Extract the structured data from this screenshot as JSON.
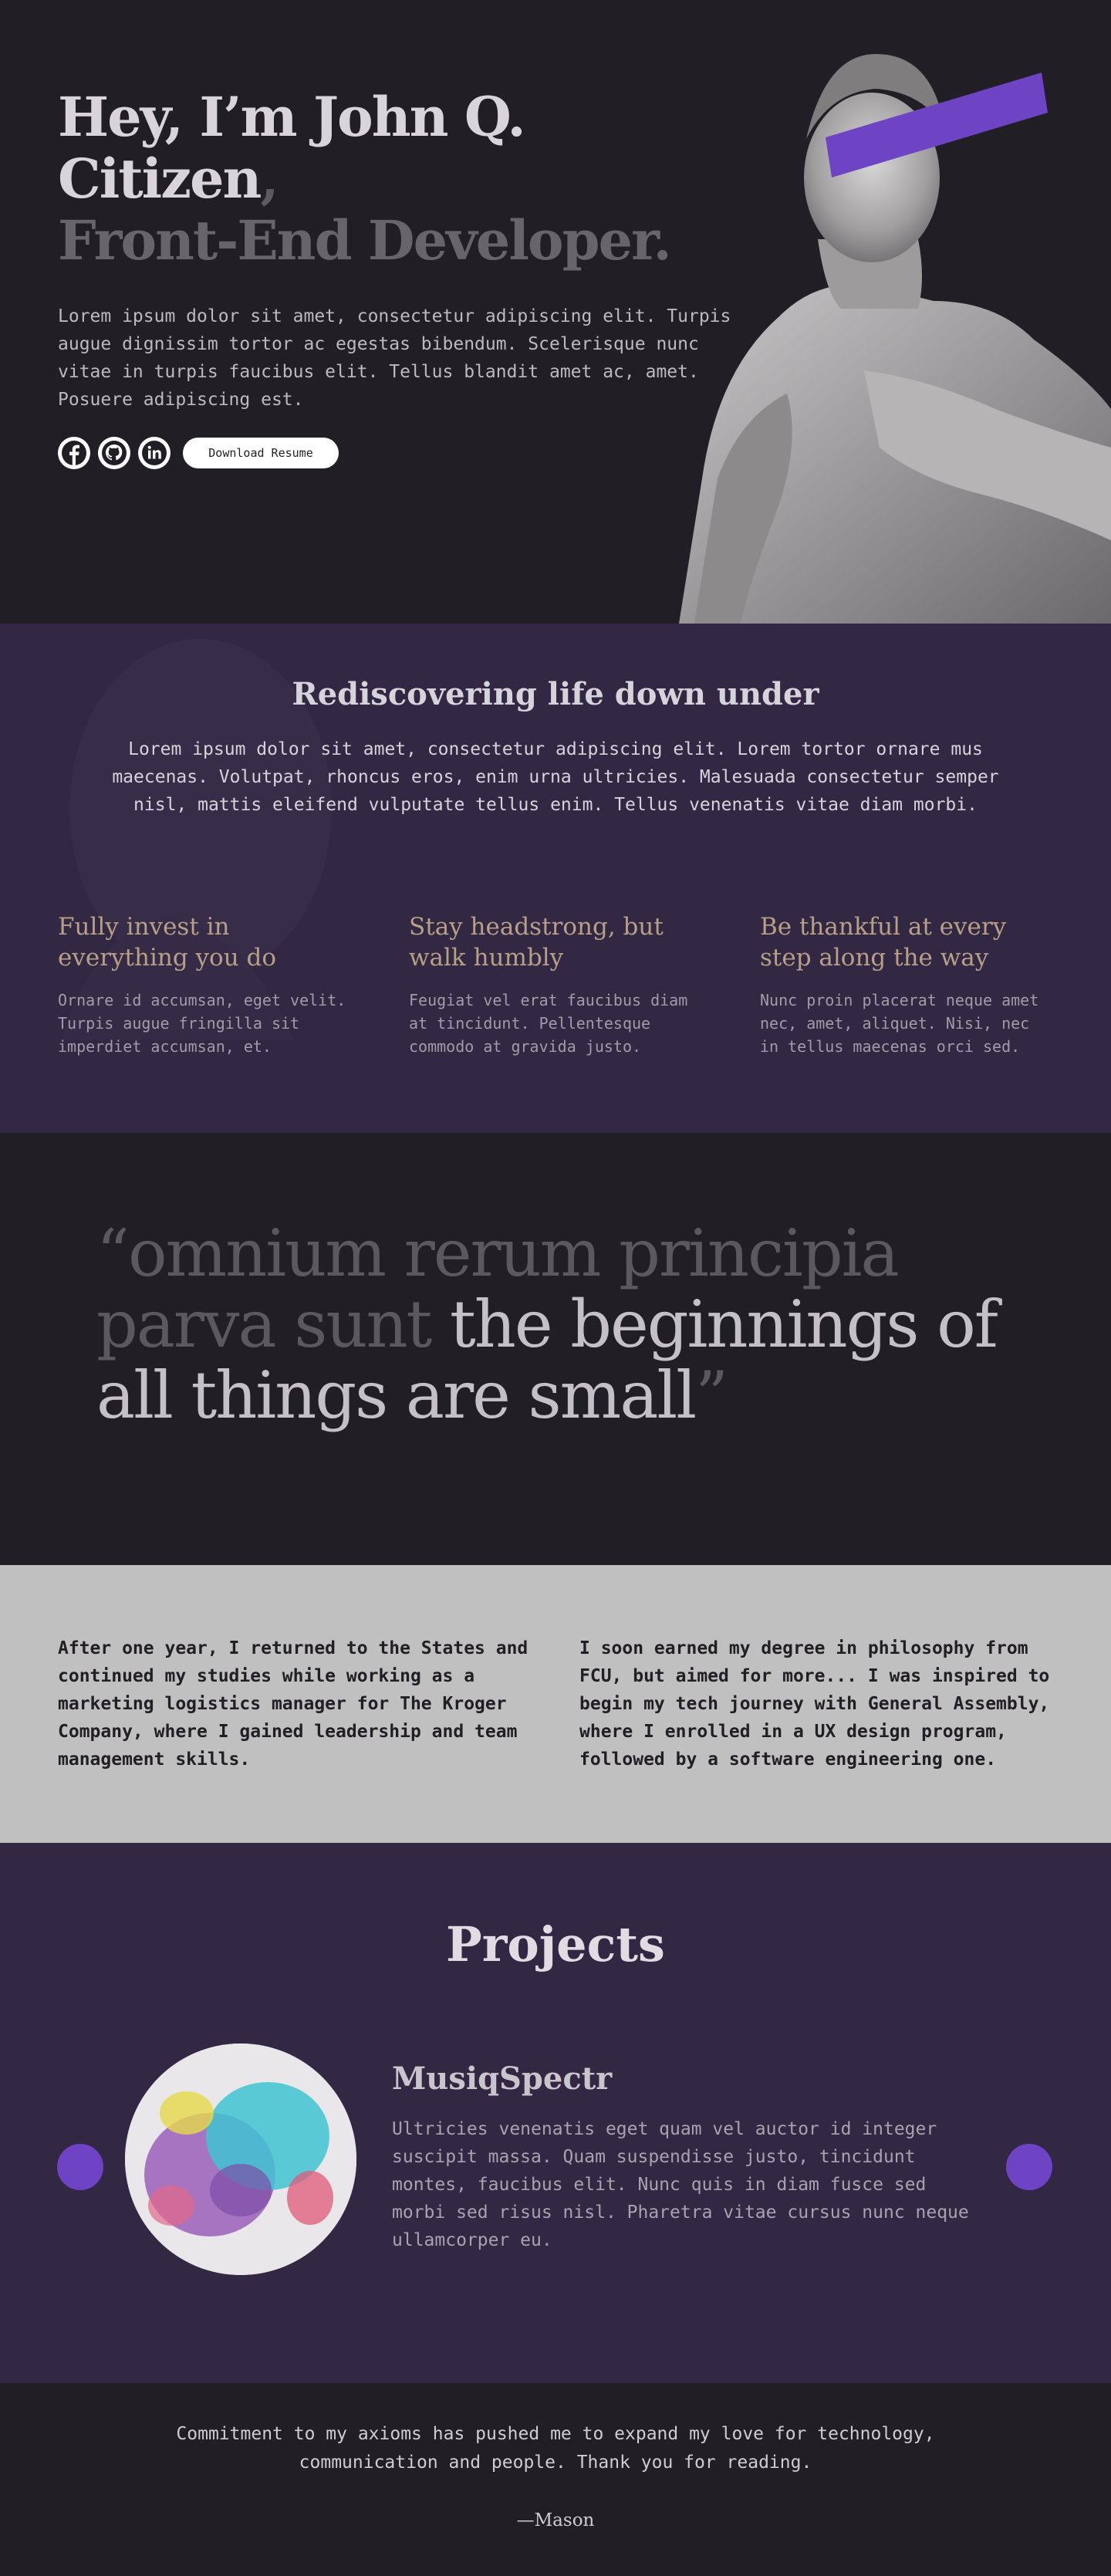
{
  "hero": {
    "title_line1": "Hey, I’m John Q. Citizen",
    "title_comma": ",",
    "title_line2": "Front-End Developer.",
    "description": "Lorem ipsum dolor sit amet, consectetur adipiscing elit. Turpis augue dignissim tortor ac egestas bibendum. Scelerisque nunc vitae in turpis faucibus elit. Tellus blandit amet ac, amet. Posuere adipiscing est.",
    "download_label": "Download Resume",
    "socials": [
      "facebook-icon",
      "github-icon",
      "linkedin-icon"
    ],
    "accent_color": "#6e44c4"
  },
  "about": {
    "title": "Rediscovering life down under",
    "lead": "Lorem ipsum dolor sit amet, consectetur adipiscing elit. Lorem tortor ornare mus maecenas. Volutpat, rhoncus eros, enim urna ultricies. Malesuada consectetur semper nisl, mattis eleifend vulputate tellus enim. Tellus venenatis vitae diam morbi.",
    "values": [
      {
        "title": "Fully invest in everything you do",
        "body": "Ornare id accumsan, eget velit. Turpis augue fringilla sit imperdiet accumsan, et."
      },
      {
        "title": "Stay headstrong, but walk humbly",
        "body": "Feugiat vel erat faucibus diam at tincidunt. Pellentesque commodo at gravida justo."
      },
      {
        "title": "Be thankful at every step along the way",
        "body": "Nunc proin placerat neque amet nec, amet, aliquet. Nisi, nec in tellus maecenas orci sed."
      }
    ]
  },
  "quote": {
    "open": "“",
    "latin": "omnium rerum principia parva sunt",
    "english": " the beginnings of all things are small",
    "close": "”"
  },
  "story": {
    "left": "After one year, I returned to the States and continued my studies while working as a marketing logistics manager for The Kroger Company, where I gained leadership and team management skills.",
    "right": "I soon earned my degree in philosophy from FCU, but aimed for more... I was inspired to begin my tech journey with General Assembly, where I enrolled in a UX design program, followed by a software engineering one."
  },
  "projects": {
    "title": "Projects",
    "item": {
      "name": "MusiqSpectr",
      "description": "Ultricies venenatis eget quam vel auctor id integer suscipit massa. Quam suspendisse justo, tincidunt montes, faucibus elit. Nunc quis in diam fusce sed morbi sed risus nisl. Pharetra vitae cursus nunc neque ullamcorper eu."
    }
  },
  "footer": {
    "message": "Commitment to my axioms has pushed me to expand my love for technology, communication and people. Thank you for reading.",
    "signature": "—Mason"
  }
}
